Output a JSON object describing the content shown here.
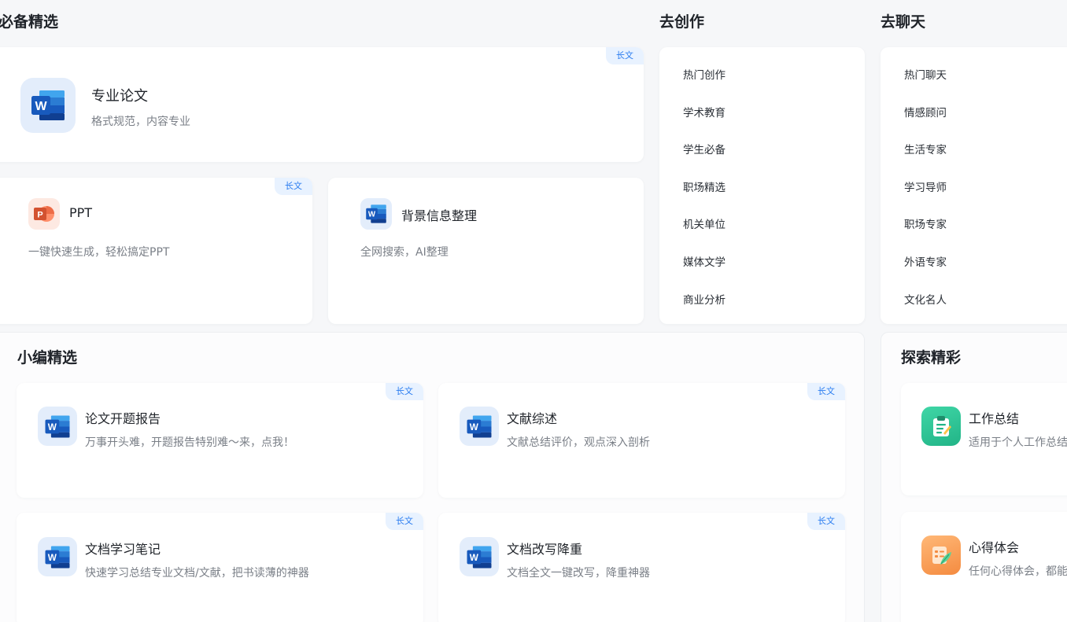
{
  "sections": {
    "must": "必备精选",
    "create": "去创作",
    "chat": "去聊天",
    "editors": "小编精选",
    "explore": "探索精彩"
  },
  "tag_label": "长文",
  "featured": {
    "title": "专业论文",
    "desc": "格式规范，内容专业",
    "tag": "长文",
    "icon": "word-icon"
  },
  "ppt": {
    "title": "PPT",
    "desc": "一键快速生成，轻松搞定PPT",
    "tag": "长文",
    "icon": "powerpoint-icon"
  },
  "background": {
    "title": "背景信息整理",
    "desc": "全网搜索，AI整理",
    "icon": "word-icon"
  },
  "create_items": [
    "热门创作",
    "学术教育",
    "学生必备",
    "职场精选",
    "机关单位",
    "媒体文学",
    "商业分析"
  ],
  "chat_items": [
    "热门聊天",
    "情感顾问",
    "生活专家",
    "学习导师",
    "职场专家",
    "外语专家",
    "文化名人"
  ],
  "editors_cards": [
    {
      "title": "论文开题报告",
      "desc": "万事开头难，开题报告特别难～来，点我！",
      "tag": "长文",
      "icon": "word-icon"
    },
    {
      "title": "文献综述",
      "desc": "文献总结评价，观点深入剖析",
      "tag": "长文",
      "icon": "word-icon"
    },
    {
      "title": "文档学习笔记",
      "desc": "快速学习总结专业文档/文献，把书读薄的神器",
      "tag": "长文",
      "icon": "word-icon"
    },
    {
      "title": "文档改写降重",
      "desc": "文档全文一键改写，降重神器",
      "tag": "长文",
      "icon": "word-icon"
    }
  ],
  "explore_cards": [
    {
      "title": "工作总结",
      "desc": "适用于个人工作总结",
      "icon": "clipboard-icon"
    },
    {
      "title": "心得体会",
      "desc": "任何心得体会，都能",
      "icon": "notes-feather-icon"
    }
  ],
  "colors": {
    "accent": "#2b7df0",
    "tag_bg": "#e8f2ff",
    "word_blue": "#185abd",
    "ppt_orange": "#d35230",
    "green": "#22b487",
    "orange": "#f48b40"
  }
}
